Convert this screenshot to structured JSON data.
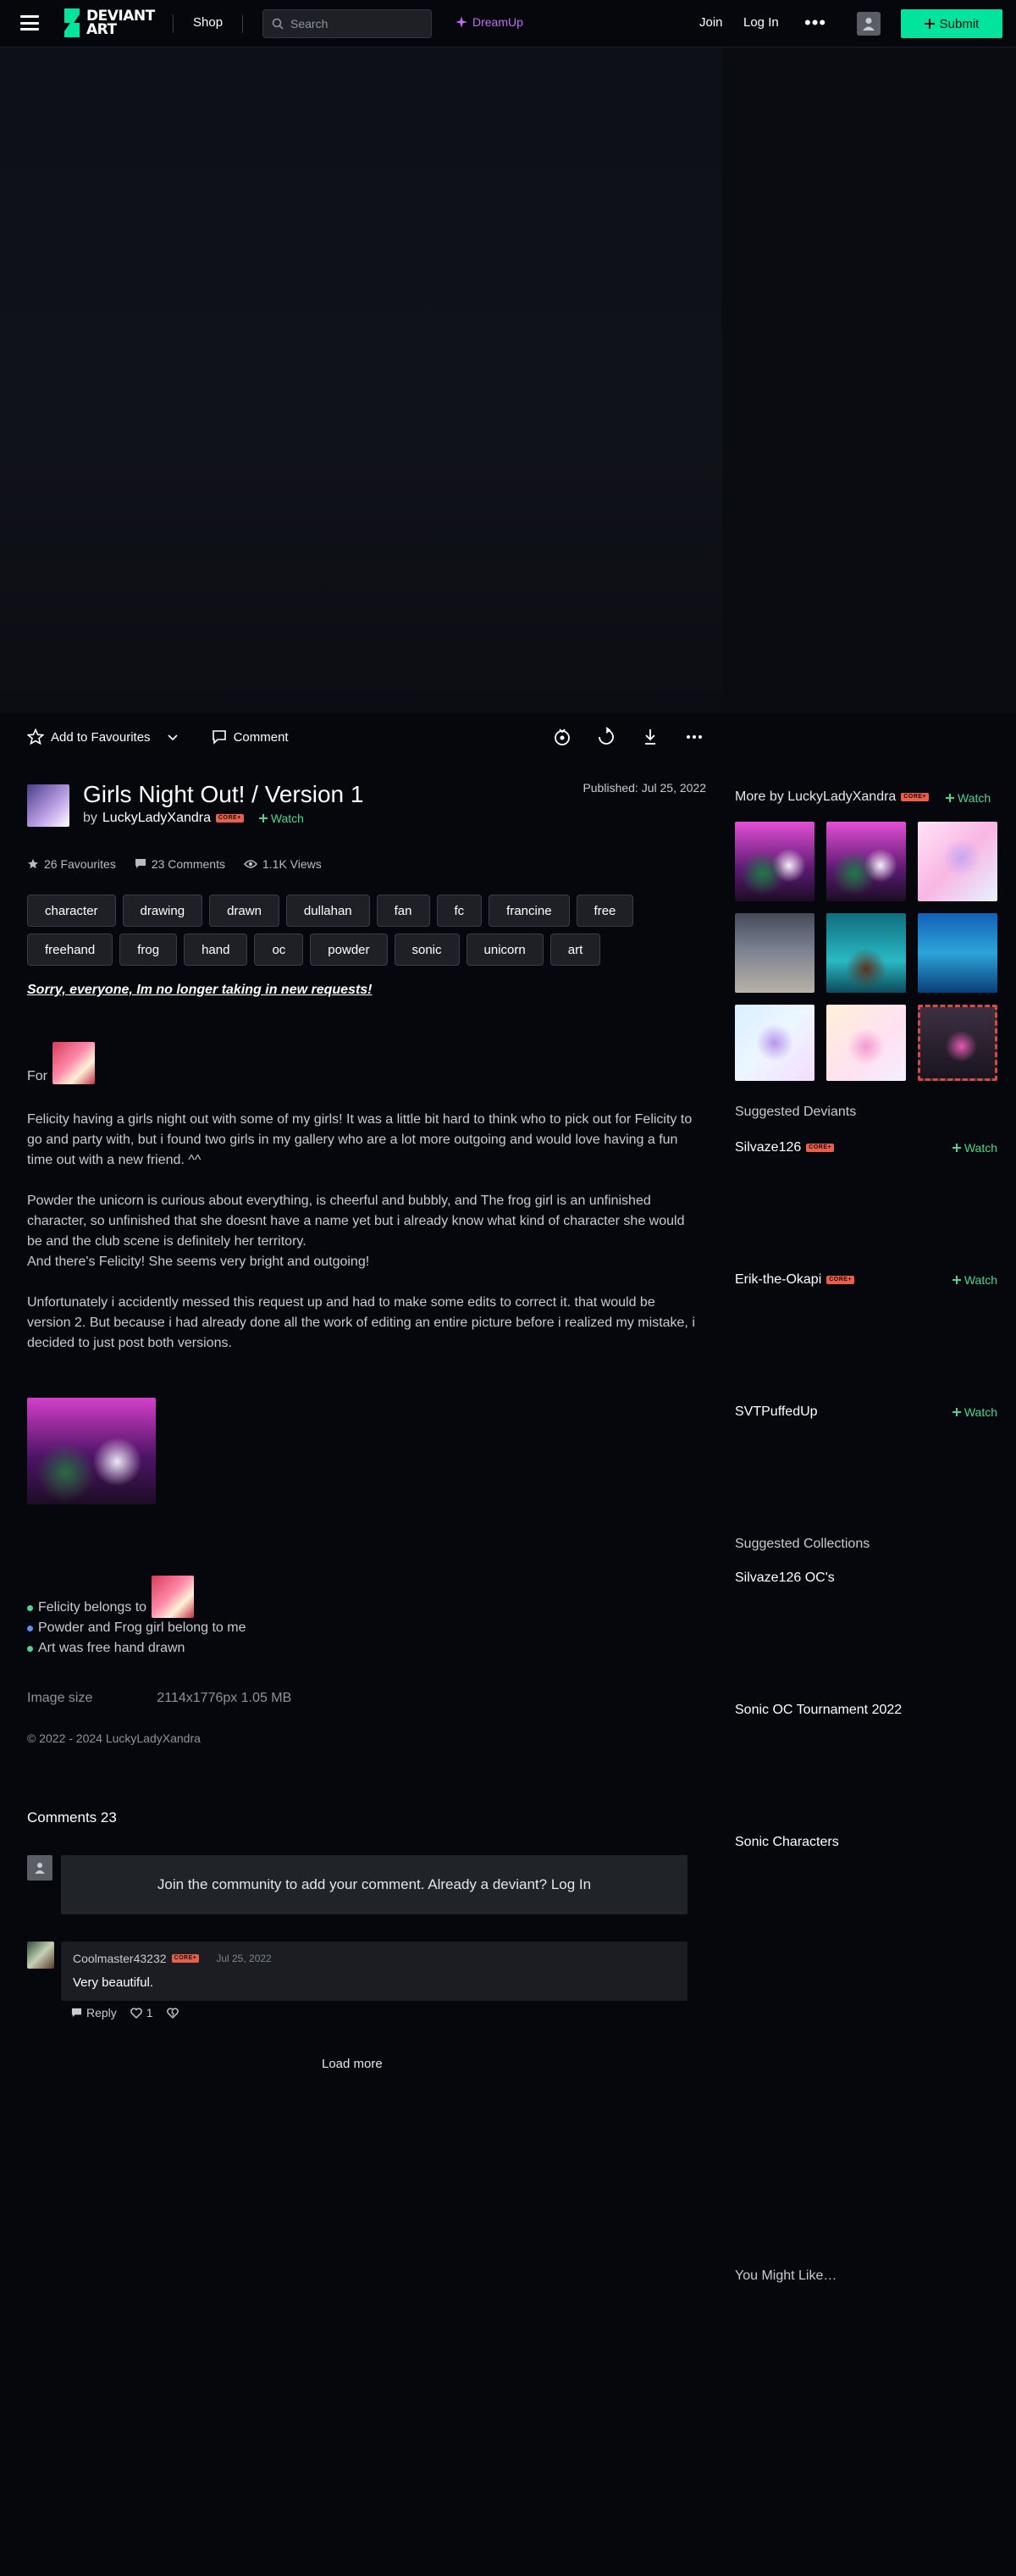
{
  "header": {
    "logo_line1": "DEVIANT",
    "logo_line2": "ART",
    "shop": "Shop",
    "search_placeholder": "Search",
    "dreamup": "DreamUp",
    "join": "Join",
    "login": "Log In",
    "submit": "Submit"
  },
  "actions": {
    "add_favourites": "Add to Favourites",
    "comment": "Comment"
  },
  "deviation": {
    "title": "Girls Night Out! / Version 1",
    "by": "by",
    "author": "LuckyLadyXandra",
    "core": "CORE+",
    "watch": "Watch",
    "published": "Published: Jul 25, 2022",
    "favourites": "26 Favourites",
    "comments": "23 Comments",
    "views": "1.1K Views",
    "tags": [
      "character",
      "drawing",
      "drawn",
      "dullahan",
      "fan",
      "fc",
      "francine",
      "free",
      "freehand",
      "frog",
      "hand",
      "oc",
      "powder",
      "sonic",
      "unicorn",
      "art"
    ]
  },
  "description": {
    "sorry": "Sorry, everyone, Im no longer taking in new requests!",
    "for": "For",
    "p1": "Felicity having a girls night out with some of my girls! It was a little bit hard to think who to pick out for Felicity to go and party with, but i found two girls in my gallery who are a lot more outgoing and would love having a fun time out with a new friend. ^^",
    "p2a": "Powder the unicorn is curious about everything, is cheerful and bubbly, and The frog girl is an unfinished character, so unfinished that she doesnt have a name yet but i already know what kind of character she would be and the club scene is definitely her territory.",
    "p2b": "And there's Felicity! She seems very bright and outgoing!",
    "p3": "Unfortunately i accidently messed this request up and had to make some edits to correct it. that would be version 2. But because i had already done all the work of editing an entire picture before i realized my mistake, i decided to just post both versions.",
    "bullet1": "Felicity belongs to",
    "bullet2": "Powder and Frog girl belong to me",
    "bullet3": "Art was free hand drawn",
    "bullet_colors": [
      "#4bd58f",
      "#5b8ef0",
      "#4bd58f"
    ],
    "image_size_label": "Image size",
    "image_size_value": "2114x1776px 1.05 MB",
    "copyright": "© 2022 - 2024 LuckyLadyXandra"
  },
  "comments": {
    "title": "Comments 23",
    "join_prompt": "Join the community to add your comment. Already a deviant? Log In",
    "user": "Coolmaster43232",
    "core": "CORE+",
    "date": "Jul 25, 2022",
    "text": "Very beautiful.",
    "reply": "Reply",
    "likes": "1",
    "load_more": "Load more"
  },
  "sidebar": {
    "more_by": "More by LuckyLadyXandra",
    "core": "CORE+",
    "watch": "Watch",
    "suggested_deviants": "Suggested Deviants",
    "deviants": [
      {
        "name": "Silvaze126",
        "core": "CORE+",
        "watch": "Watch"
      },
      {
        "name": "Erik-the-Okapi",
        "core": "CORE+",
        "watch": "Watch"
      },
      {
        "name": "SVTPuffedUp",
        "core": "",
        "watch": "Watch"
      }
    ],
    "suggested_collections": "Suggested Collections",
    "collections": [
      "Silvaze126 OC's",
      "Sonic OC Tournament 2022",
      "Sonic Characters"
    ],
    "you_might_like": "You Might Like…"
  },
  "colors": {
    "accent_green": "#00e59b",
    "watch_green": "#4bd58f",
    "dreamup_purple": "#c56bf0",
    "core_orange": "#e8604c",
    "background": "#06070d"
  }
}
